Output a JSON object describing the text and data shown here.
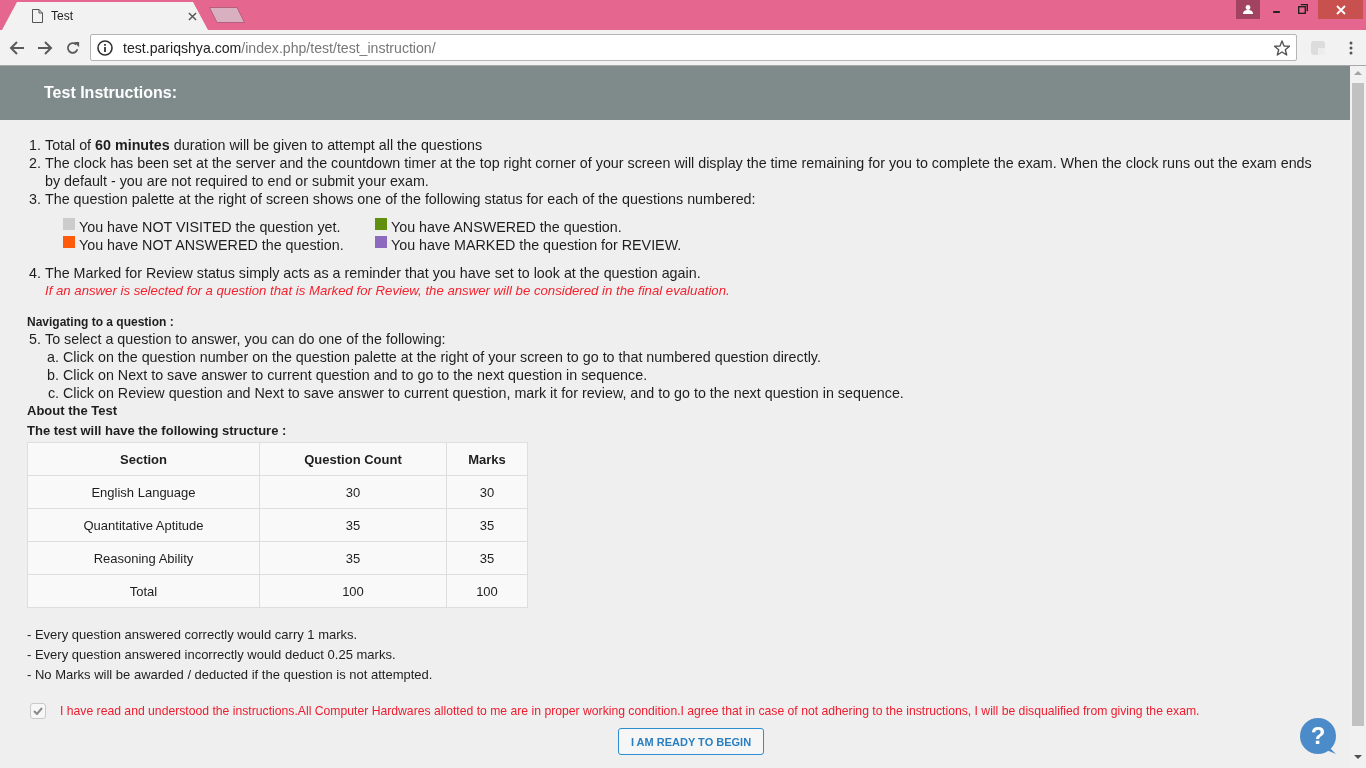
{
  "browser": {
    "tab": {
      "title": "Test"
    },
    "address": {
      "host": "test.pariqshya.com",
      "path": "/index.php/test/test_instruction/"
    }
  },
  "header": {
    "title": "Test Instructions:"
  },
  "instructions": [
    {
      "number": "1.",
      "text": "Total of **60 minutes** duration will be given to attempt all the questions"
    },
    {
      "number": "2.",
      "text": "The clock has been set at the server and the countdown timer at the top right corner of your screen will display the time remaining for you to complete the exam. When the clock runs out the exam ends by default - you are not required to end or submit your exam."
    },
    {
      "number": "3.",
      "text": "The question palette at the right of screen shows one of the following status for each of the questions numbered:",
      "legend": [
        {
          "color": "#cccccc",
          "text": "You have NOT VISITED the question yet."
        },
        {
          "color": "#5f8f0d",
          "text": "You have ANSWERED the question."
        },
        {
          "color": "#ff5b0a",
          "text": "You have NOT ANSWERED the question."
        },
        {
          "color": "#8c6bbf",
          "text": "You have MARKED the question for REVIEW."
        }
      ]
    },
    {
      "number": "4.",
      "text": "The Marked for Review status simply acts as a reminder that you have set to look at the question again.",
      "note": "If an answer is selected for a question that is Marked for Review, the answer will be considered in the final evaluation."
    }
  ],
  "navigation": {
    "heading": "Navigating to a question :",
    "number": "5.",
    "text": "To select a question to answer, you can do one of the following:",
    "steps": [
      {
        "label": "a.",
        "text": "Click on the question number on the question palette at the right of your screen to go to that numbered question directly."
      },
      {
        "label": "b.",
        "text": "Click on Next to save answer to current question and to go to the next question in sequence."
      },
      {
        "label": "c.",
        "text": "Click on Review question and Next to save answer to current question, mark it for review, and to go to the next question in sequence."
      }
    ]
  },
  "about": {
    "heading": "About the Test",
    "subheading": "The test will have the following structure :"
  },
  "table": {
    "columns": [
      "Section",
      "Question Count",
      "Marks"
    ],
    "rows": [
      [
        "English Language",
        "30",
        "30"
      ],
      [
        "Quantitative Aptitude",
        "35",
        "35"
      ],
      [
        "Reasoning Ability",
        "35",
        "35"
      ],
      [
        "Total",
        "100",
        "100"
      ]
    ]
  },
  "marking_notes": [
    "- Every question answered correctly would carry 1 marks.",
    "- Every question answered incorrectly would deduct 0.25 marks.",
    "- No Marks will be awarded / deducted if the question is not attempted."
  ],
  "agreement": {
    "checked": true,
    "text": "I have read and understood the instructions.All Computer Hardwares allotted to me are in proper working condition.I agree that in case of not adhering to the instructions, I will be disqualified from giving the exam."
  },
  "begin_button": {
    "label": "I AM READY TO BEGIN"
  },
  "help_button": {
    "label": "?"
  }
}
